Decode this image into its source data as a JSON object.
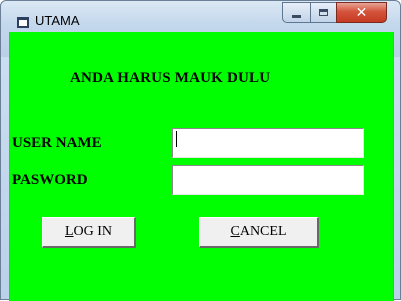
{
  "window": {
    "title": "UTAMA",
    "controls": {
      "minimize": "minimize",
      "maximize": "maximize",
      "close": "close"
    }
  },
  "form": {
    "heading": "ANDA HARUS MAUK DULU",
    "username_label": "USER NAME",
    "password_label": "PASWORD",
    "username_value": "",
    "password_value": ""
  },
  "buttons": {
    "login": {
      "mnemonic": "L",
      "rest": "OG IN"
    },
    "cancel": {
      "mnemonic": "C",
      "rest": "ANCEL"
    }
  },
  "colors": {
    "form_background": "#00ff00",
    "close_button": "#c53a22"
  }
}
